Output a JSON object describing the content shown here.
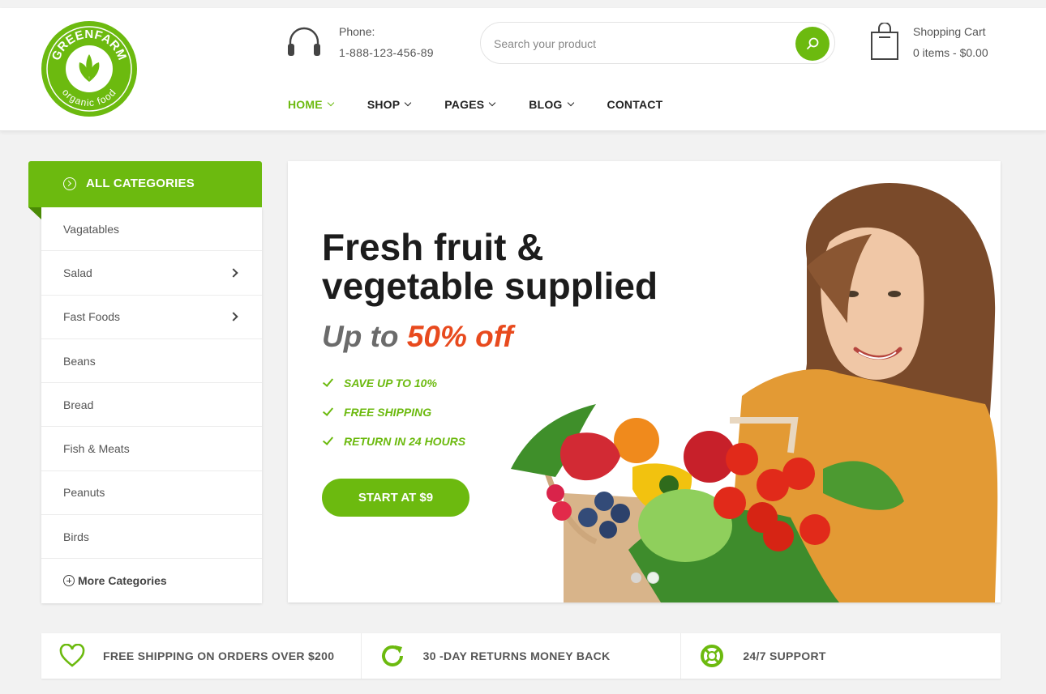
{
  "brand": {
    "logo_top_text": "GREENFARM",
    "logo_bottom_text": "organic food",
    "accent": "#6cba0f",
    "sale_color": "#e84a1e"
  },
  "header": {
    "phone_label": "Phone:",
    "phone_number": "1-888-123-456-89",
    "search_placeholder": "Search your product",
    "cart_label": "Shopping Cart",
    "cart_summary": "0 items - $0.00"
  },
  "nav": {
    "items": [
      {
        "label": "HOME",
        "active": true
      },
      {
        "label": "SHOP"
      },
      {
        "label": "PAGES"
      },
      {
        "label": "BLOG"
      },
      {
        "label": "CONTACT"
      }
    ]
  },
  "sidebar": {
    "title": "ALL CATEGORIES",
    "items": [
      {
        "label": "Vagatables"
      },
      {
        "label": "Salad"
      },
      {
        "label": "Fast Foods"
      },
      {
        "label": "Beans"
      },
      {
        "label": "Bread"
      },
      {
        "label": "Fish & Meats"
      },
      {
        "label": "Peanuts"
      },
      {
        "label": "Birds"
      }
    ],
    "more": "More Categories"
  },
  "banner": {
    "headline_1": "Fresh fruit &",
    "headline_2": "vegetable supplied",
    "offer_prefix": "Up to ",
    "offer_value": "50% off",
    "features": [
      "SAVE UP TO 10%",
      "FREE SHIPPING",
      "RETURN IN 24 HOURS"
    ],
    "cta": "START AT $9"
  },
  "features_bar": [
    {
      "icon": "heart-icon",
      "label": "FREE SHIPPING ON ORDERS OVER $200"
    },
    {
      "icon": "refresh-icon",
      "label": "30 -DAY RETURNS MONEY BACK"
    },
    {
      "icon": "lifebuoy-icon",
      "label": "24/7 SUPPORT"
    }
  ]
}
